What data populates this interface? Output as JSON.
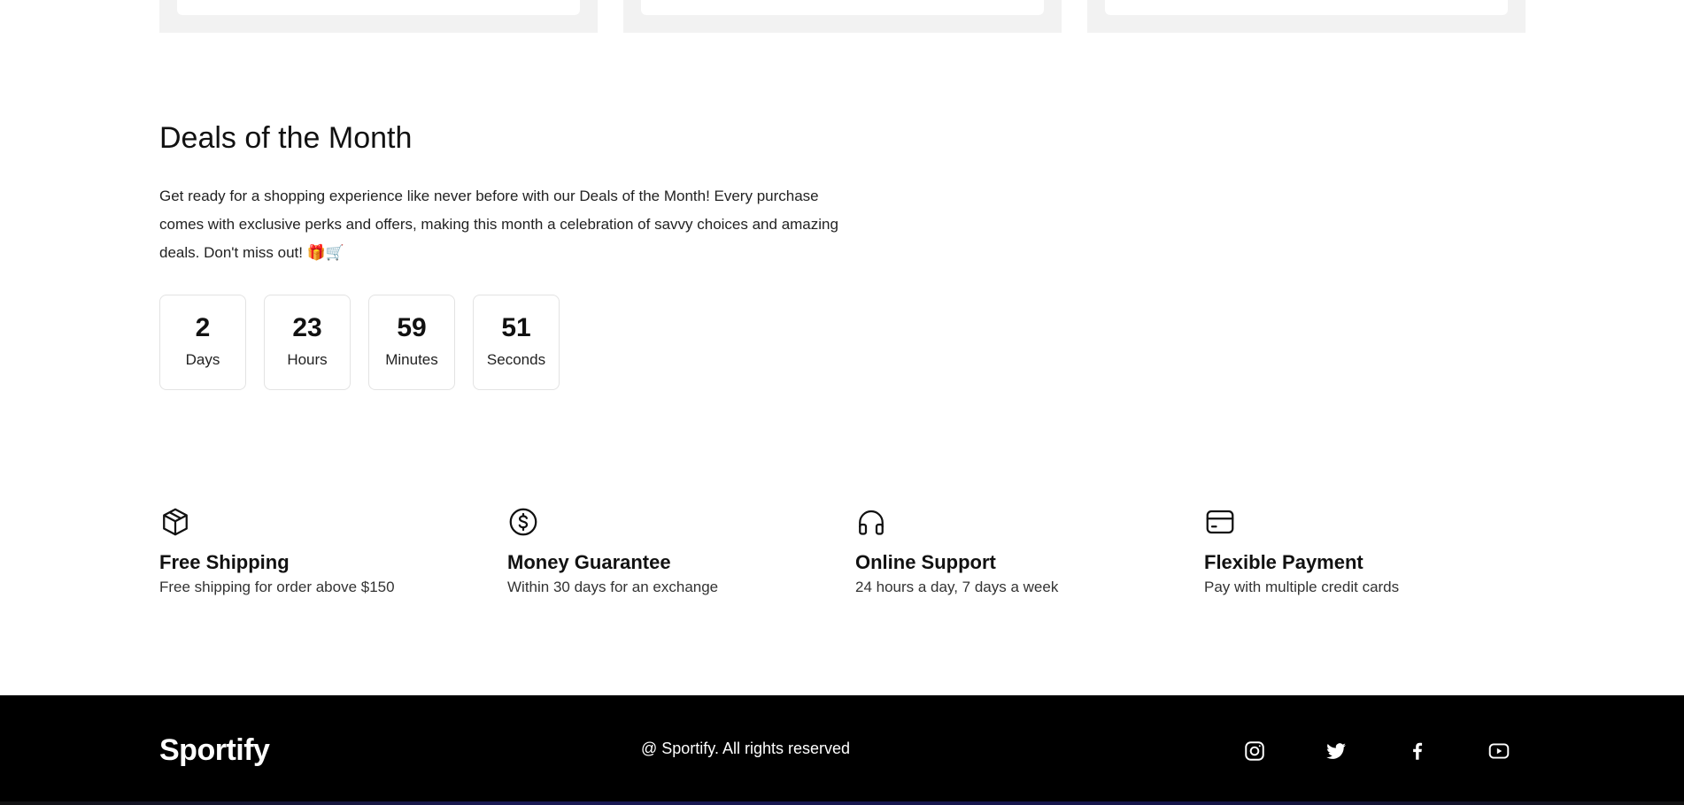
{
  "deals": {
    "title": "Deals of the Month",
    "description": "Get ready for a shopping experience like never before with our Deals of the Month! Every purchase comes with exclusive perks and offers, making this month a celebration of savvy choices and amazing deals. Don't miss out! 🎁🛒",
    "countdown": [
      {
        "value": "2",
        "label": "Days"
      },
      {
        "value": "23",
        "label": "Hours"
      },
      {
        "value": "59",
        "label": "Minutes"
      },
      {
        "value": "51",
        "label": "Seconds"
      }
    ]
  },
  "features": [
    {
      "icon": "box-icon",
      "title": "Free Shipping",
      "desc": "Free shipping for order above $150"
    },
    {
      "icon": "dollar-circle-icon",
      "title": "Money Guarantee",
      "desc": "Within 30 days for an exchange"
    },
    {
      "icon": "headphones-icon",
      "title": "Online Support",
      "desc": "24 hours a day, 7 days a week"
    },
    {
      "icon": "credit-card-icon",
      "title": "Flexible Payment",
      "desc": "Pay with multiple credit cards"
    }
  ],
  "footer": {
    "logo": "Sportify",
    "copyright": "@ Sportify. All rights reserved",
    "socials": [
      "instagram-icon",
      "twitter-icon",
      "facebook-icon",
      "youtube-icon"
    ]
  },
  "colors": {
    "footer_bg": "#000000",
    "text": "#111111",
    "card_bg": "#f2f2f2"
  }
}
